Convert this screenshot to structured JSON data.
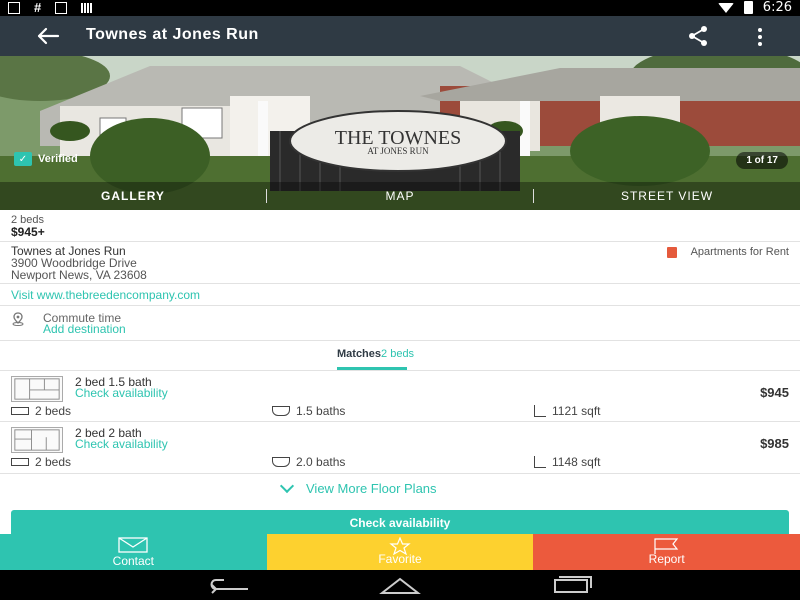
{
  "status_bar": {
    "time": "6:26"
  },
  "app_bar": {
    "title": "Townes at Jones Run"
  },
  "gallery": {
    "sign_line1": "THE TOWNES",
    "sign_line2": "AT JONES RUN",
    "verified_label": "Verified",
    "photo_count": "1 of 17",
    "tabs": [
      "GALLERY",
      "MAP",
      "STREET VIEW"
    ],
    "active_tab": "GALLERY"
  },
  "summary": {
    "beds": "2 beds",
    "price": "$945+"
  },
  "address": {
    "name": "Townes at Jones Run",
    "street": "3900 Woodbridge Drive",
    "city": "Newport News, VA 23608",
    "type": "Apartments for Rent"
  },
  "website_link": "Visit www.thebreedencompany.com",
  "commute": {
    "label": "Commute time",
    "link": "Add destination"
  },
  "matches": {
    "label": "Matches",
    "beds": "2 beds"
  },
  "floor_plans": [
    {
      "name": "2 bed 1.5 bath",
      "action": "Check availability",
      "price": "$945",
      "beds": "2 beds",
      "baths": "1.5 baths",
      "sqft": "1121 sqft"
    },
    {
      "name": "2 bed 2 bath",
      "action": "Check availability",
      "price": "$985",
      "beds": "2 beds",
      "baths": "2.0 baths",
      "sqft": "1148 sqft"
    }
  ],
  "view_more": "View More Floor Plans",
  "check_availability_button": "Check availability",
  "actions": {
    "contact": "Contact",
    "favorite": "Favorite",
    "report": "Report"
  },
  "colors": {
    "teal": "#2ec4b0",
    "yellow": "#fdd12f",
    "orange": "#ec5a3d",
    "header": "#2f3a44"
  },
  "icons": [
    "back-arrow-icon",
    "share-icon",
    "more-vert-icon",
    "check-icon",
    "building-icon",
    "location-pin-icon",
    "bed-icon",
    "bath-icon",
    "sqft-icon",
    "chevron-down-icon",
    "mail-icon",
    "star-icon",
    "flag-icon"
  ]
}
